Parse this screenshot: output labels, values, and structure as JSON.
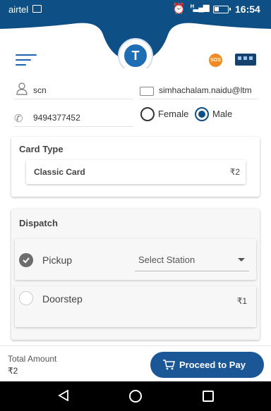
{
  "statusbar": {
    "carrier": "airtel",
    "time": "16:54",
    "icons": [
      "gallery-icon",
      "alarm-icon",
      "signal-icon",
      "battery-icon"
    ]
  },
  "header": {
    "sos_label": "SOS",
    "logo_letter": "T",
    "icons": [
      "menu-icon",
      "logo-icon",
      "sos-icon",
      "bus-icon"
    ]
  },
  "form": {
    "name": "scn",
    "email": "simhachalam.naidu@ltm",
    "phone": "9494377452",
    "gender": {
      "options": [
        "Female",
        "Male"
      ],
      "selected": "Male"
    }
  },
  "card_type": {
    "title": "Card Type",
    "card_name": "Classic Card",
    "card_price": "₹2"
  },
  "dispatch": {
    "title": "Dispatch",
    "pickup": {
      "label": "Pickup",
      "selected": true,
      "station_placeholder": "Select Station"
    },
    "doorstep": {
      "label": "Doorstep",
      "selected": false,
      "price": "₹1"
    }
  },
  "footer": {
    "total_label": "Total Amount",
    "total_value": "₹2",
    "pay_label": "Proceed to Pay"
  },
  "colors": {
    "primary": "#0e4f86",
    "button": "#1b5796",
    "sos": "#f08a24"
  }
}
